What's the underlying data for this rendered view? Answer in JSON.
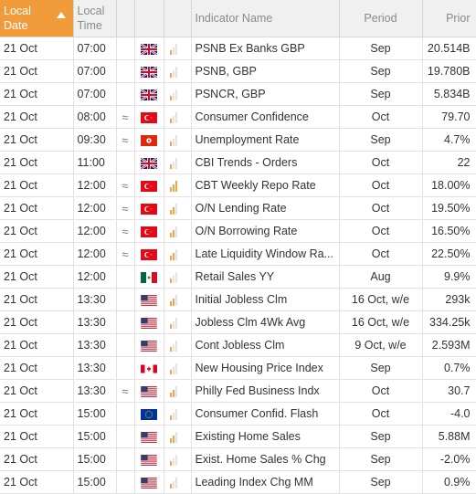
{
  "header": {
    "local_date": "Local\nDate",
    "local_time": "Local\nTime",
    "indicator_name": "Indicator Name",
    "period": "Period",
    "prior": "Prior"
  },
  "colors": {
    "accent": "#f29b3b",
    "importance": "#f2a34a"
  },
  "rows": [
    {
      "date": "21 Oct",
      "time": "07:00",
      "approx": "",
      "flag": "gb-flag-icon",
      "importance": 1,
      "name": "PSNB Ex Banks GBP",
      "period": "Sep",
      "prior": "20.514B"
    },
    {
      "date": "21 Oct",
      "time": "07:00",
      "approx": "",
      "flag": "gb-flag-icon",
      "importance": 1,
      "name": "PSNB, GBP",
      "period": "Sep",
      "prior": "19.780B"
    },
    {
      "date": "21 Oct",
      "time": "07:00",
      "approx": "",
      "flag": "gb-flag-icon",
      "importance": 1,
      "name": "PSNCR, GBP",
      "period": "Sep",
      "prior": "5.834B"
    },
    {
      "date": "21 Oct",
      "time": "08:00",
      "approx": "≈",
      "flag": "tr-flag-icon",
      "importance": 1,
      "name": "Consumer Confidence",
      "period": "Oct",
      "prior": "79.70"
    },
    {
      "date": "21 Oct",
      "time": "09:30",
      "approx": "≈",
      "flag": "hk-flag-icon",
      "importance": 1,
      "name": "Unemployment Rate",
      "period": "Sep",
      "prior": "4.7%"
    },
    {
      "date": "21 Oct",
      "time": "11:00",
      "approx": "",
      "flag": "gb-flag-icon",
      "importance": 1,
      "name": "CBI Trends - Orders",
      "period": "Oct",
      "prior": "22"
    },
    {
      "date": "21 Oct",
      "time": "12:00",
      "approx": "≈",
      "flag": "tr-flag-icon",
      "importance": 3,
      "name": "CBT Weekly Repo Rate",
      "period": "Oct",
      "prior": "18.00%"
    },
    {
      "date": "21 Oct",
      "time": "12:00",
      "approx": "≈",
      "flag": "tr-flag-icon",
      "importance": 2,
      "name": "O/N Lending Rate",
      "period": "Oct",
      "prior": "19.50%"
    },
    {
      "date": "21 Oct",
      "time": "12:00",
      "approx": "≈",
      "flag": "tr-flag-icon",
      "importance": 2,
      "name": "O/N Borrowing Rate",
      "period": "Oct",
      "prior": "16.50%"
    },
    {
      "date": "21 Oct",
      "time": "12:00",
      "approx": "≈",
      "flag": "tr-flag-icon",
      "importance": 2,
      "name": "Late Liquidity Window Ra...",
      "period": "Oct",
      "prior": "22.50%"
    },
    {
      "date": "21 Oct",
      "time": "12:00",
      "approx": "",
      "flag": "mx-flag-icon",
      "importance": 1,
      "name": "Retail Sales YY",
      "period": "Aug",
      "prior": "9.9%"
    },
    {
      "date": "21 Oct",
      "time": "13:30",
      "approx": "",
      "flag": "us-flag-icon",
      "importance": 2,
      "name": "Initial Jobless Clm",
      "period": "16 Oct, w/e",
      "prior": "293k"
    },
    {
      "date": "21 Oct",
      "time": "13:30",
      "approx": "",
      "flag": "us-flag-icon",
      "importance": 1,
      "name": "Jobless Clm 4Wk Avg",
      "period": "16 Oct, w/e",
      "prior": "334.25k"
    },
    {
      "date": "21 Oct",
      "time": "13:30",
      "approx": "",
      "flag": "us-flag-icon",
      "importance": 1,
      "name": "Cont Jobless Clm",
      "period": "9 Oct, w/e",
      "prior": "2.593M"
    },
    {
      "date": "21 Oct",
      "time": "13:30",
      "approx": "",
      "flag": "ca-flag-icon",
      "importance": 1,
      "name": "New Housing Price Index",
      "period": "Sep",
      "prior": "0.7%"
    },
    {
      "date": "21 Oct",
      "time": "13:30",
      "approx": "≈",
      "flag": "us-flag-icon",
      "importance": 2,
      "name": "Philly Fed Business Indx",
      "period": "Oct",
      "prior": "30.7"
    },
    {
      "date": "21 Oct",
      "time": "15:00",
      "approx": "",
      "flag": "eu-flag-icon",
      "importance": 1,
      "name": "Consumer Confid. Flash",
      "period": "Oct",
      "prior": "-4.0"
    },
    {
      "date": "21 Oct",
      "time": "15:00",
      "approx": "",
      "flag": "us-flag-icon",
      "importance": 2,
      "name": "Existing Home Sales",
      "period": "Sep",
      "prior": "5.88M"
    },
    {
      "date": "21 Oct",
      "time": "15:00",
      "approx": "",
      "flag": "us-flag-icon",
      "importance": 1,
      "name": "Exist. Home Sales % Chg",
      "period": "Sep",
      "prior": "-2.0%"
    },
    {
      "date": "21 Oct",
      "time": "15:00",
      "approx": "",
      "flag": "us-flag-icon",
      "importance": 1,
      "name": "Leading Index Chg MM",
      "period": "Sep",
      "prior": "0.9%"
    }
  ]
}
